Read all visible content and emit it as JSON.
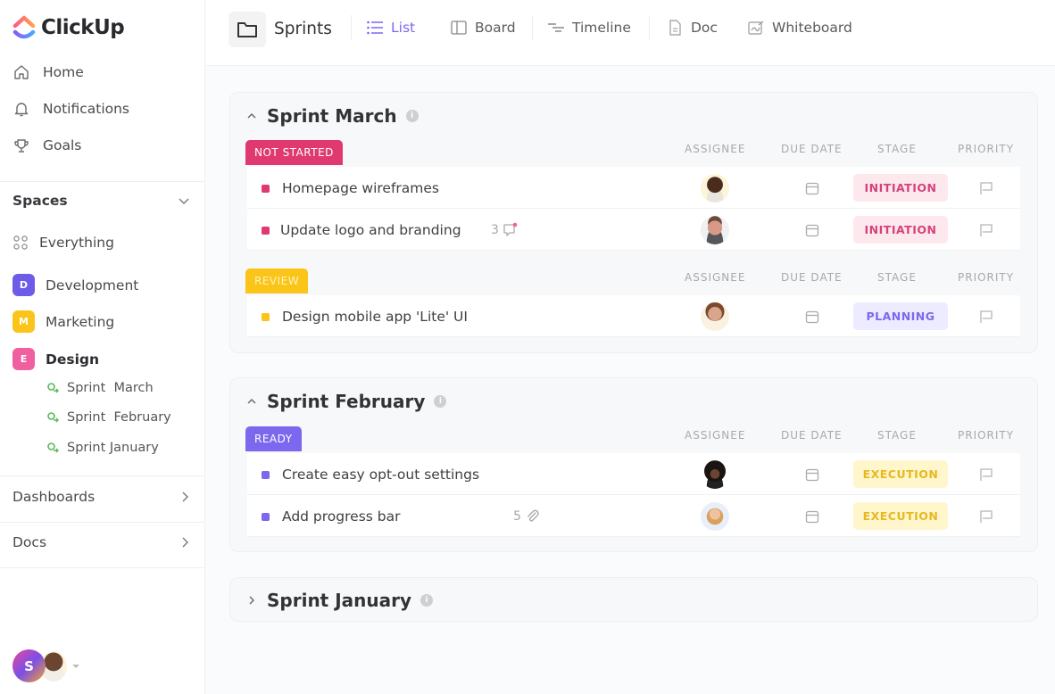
{
  "app": {
    "brand": "ClickUp",
    "colors": {
      "accent": "#7b68ee",
      "not_started": "#e0396f",
      "review": "#fbc418",
      "ready": "#7b68ee",
      "initiation_bg": "#fde8ee",
      "initiation_text": "#d6427a",
      "planning_bg": "#ecebff",
      "planning_text": "#7b68ee",
      "execution_bg": "#fff6cc",
      "execution_text": "#e8b820"
    }
  },
  "sidebar": {
    "nav": [
      {
        "label": "Home",
        "icon": "home-icon"
      },
      {
        "label": "Notifications",
        "icon": "bell-icon"
      },
      {
        "label": "Goals",
        "icon": "trophy-icon"
      }
    ],
    "spaces_label": "Spaces",
    "everything_label": "Everything",
    "spaces": [
      {
        "letter": "D",
        "label": "Development",
        "color": "#6c5ce7"
      },
      {
        "letter": "M",
        "label": "Marketing",
        "color": "#fbc418"
      },
      {
        "letter": "E",
        "label": "Design",
        "color": "#f060a0"
      }
    ],
    "sprints": [
      {
        "label": "Sprint  March"
      },
      {
        "label": "Sprint  February"
      },
      {
        "label": "Sprint January"
      }
    ],
    "dashboards_label": "Dashboards",
    "docs_label": "Docs",
    "user_initial": "S"
  },
  "topbar": {
    "title": "Sprints",
    "tabs": [
      {
        "label": "List",
        "icon": "list-icon",
        "active": true
      },
      {
        "label": "Board",
        "icon": "board-icon"
      },
      {
        "label": "Timeline",
        "icon": "timeline-icon"
      },
      {
        "label": "Doc",
        "icon": "doc-icon"
      },
      {
        "label": "Whiteboard",
        "icon": "whiteboard-icon"
      }
    ]
  },
  "columns": {
    "assignee": "ASSIGNEE",
    "due_date": "DUE DATE",
    "stage": "STAGE",
    "priority": "PRIORITY"
  },
  "sprints": [
    {
      "name": "Sprint March",
      "expanded": true,
      "groups": [
        {
          "status": "NOT STARTED",
          "tasks": [
            {
              "name": "Homepage wireframes",
              "stage": "INITIATION"
            },
            {
              "name": "Update logo and branding",
              "comments": "3",
              "stage": "INITIATION"
            }
          ]
        },
        {
          "status": "REVIEW",
          "tasks": [
            {
              "name": "Design mobile app 'Lite' UI",
              "stage": "PLANNING"
            }
          ]
        }
      ]
    },
    {
      "name": "Sprint February",
      "expanded": true,
      "groups": [
        {
          "status": "READY",
          "tasks": [
            {
              "name": "Create easy opt-out settings",
              "stage": "EXECUTION"
            },
            {
              "name": "Add progress bar",
              "attachments": "5",
              "stage": "EXECUTION"
            }
          ]
        }
      ]
    },
    {
      "name": "Sprint January",
      "expanded": false
    }
  ]
}
